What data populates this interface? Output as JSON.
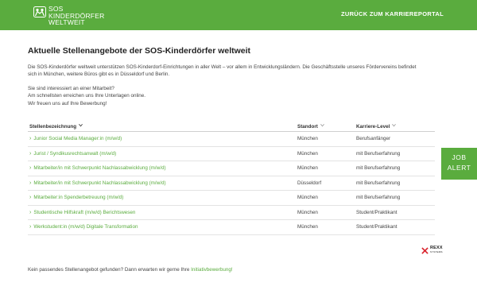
{
  "header": {
    "logo_line1": "SOS",
    "logo_line2": "KINDERDÖRFER",
    "logo_line3": "WELTWEIT",
    "back_link": "ZURÜCK ZUM KARRIEREPORTAL",
    "color": "#5aac3e"
  },
  "main": {
    "title": "Aktuelle Stellenangebote der SOS-Kinderdörfer weltweit",
    "intro": "Die SOS-Kinderdörfer weltweit unterstützen SOS-Kinderdorf-Einrichtungen in aller Welt – vor allem in Entwicklungsländern. Die Geschäftsstelle unseres Fördervereins befindet sich in München, weitere Büros gibt es in Düsseldorf und Berlin.",
    "line1": "Sie sind interessiert an einer Mitarbeit?",
    "line2": "Am schnellsten erreichen uns Ihre Unterlagen online.",
    "line3": "Wir freuen uns auf Ihre Bewerbung!"
  },
  "table": {
    "headers": [
      "Stellenbezeichnung",
      "Standort",
      "Karriere-Level"
    ],
    "rows": [
      {
        "title": "Junior Social Media Manager:in (m/w/d)",
        "location": "München",
        "level": "Berufsanfänger"
      },
      {
        "title": "Jurist / Syndikusrechtsanwalt (m/w/d)",
        "location": "München",
        "level": "mit Berufserfahrung"
      },
      {
        "title": "Mitarbeiter/in mit Schwerpunkt Nachlassabwicklung (m/w/d)",
        "location": "München",
        "level": "mit Berufserfahrung"
      },
      {
        "title": "Mitarbeiter/in mit Schwerpunkt Nachlassabwicklung (m/w/d)",
        "location": "Düsseldorf",
        "level": "mit Berufserfahrung"
      },
      {
        "title": "Mitarbeiter:in Spenderbetreuung (m/w/d)",
        "location": "München",
        "level": "mit Berufserfahrung"
      },
      {
        "title": "Studentische Hilfskraft (m/w/d) Berichtswesen",
        "location": "München",
        "level": "Student/Praktikant"
      },
      {
        "title": "Werkstudent:in (m/w/d) Digitale Transformation",
        "location": "München",
        "level": "Student/Praktikant"
      }
    ]
  },
  "job_alert": {
    "line1": "JOB",
    "line2": "ALERT"
  },
  "rexx": {
    "name": "REXX",
    "sub": "SYSTEMS"
  },
  "footer": {
    "text": "Kein passendes Stellenangebot gefunden? Dann erwarten wir gerne Ihre ",
    "link": "Initiativbewerbung!"
  }
}
